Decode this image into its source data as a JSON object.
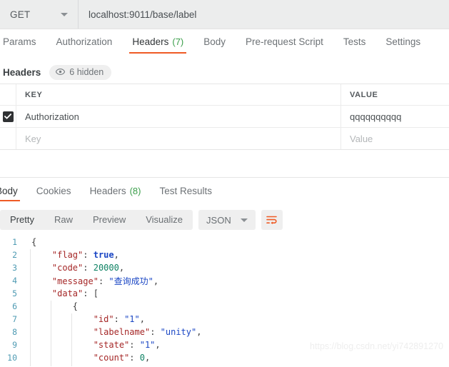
{
  "request_bar": {
    "method": "GET",
    "url": "localhost:9011/base/label",
    "caret_icon": "chevron-down-icon"
  },
  "request_tabs": [
    {
      "label": "Params",
      "count": "",
      "active": false
    },
    {
      "label": "Authorization",
      "count": "",
      "active": false
    },
    {
      "label": "Headers",
      "count": "(7)",
      "active": true
    },
    {
      "label": "Body",
      "count": "",
      "active": false
    },
    {
      "label": "Pre-request Script",
      "count": "",
      "active": false
    },
    {
      "label": "Tests",
      "count": "",
      "active": false
    },
    {
      "label": "Settings",
      "count": "",
      "active": false
    }
  ],
  "headers_section": {
    "title": "Headers",
    "hidden_pill": {
      "icon": "eye-icon",
      "label": "6 hidden"
    },
    "columns": {
      "key": "KEY",
      "value": "VALUE"
    },
    "rows": [
      {
        "checked": true,
        "key": "Authorization",
        "value": "qqqqqqqqqq"
      }
    ],
    "new_row": {
      "key_placeholder": "Key",
      "value_placeholder": "Value"
    }
  },
  "response_tabs": [
    {
      "label": "Body",
      "count": "",
      "active": true
    },
    {
      "label": "Cookies",
      "count": "",
      "active": false
    },
    {
      "label": "Headers",
      "count": "(8)",
      "active": false
    },
    {
      "label": "Test Results",
      "count": "",
      "active": false
    }
  ],
  "format_bar": {
    "views": [
      {
        "label": "Pretty",
        "active": true
      },
      {
        "label": "Raw",
        "active": false
      },
      {
        "label": "Preview",
        "active": false
      },
      {
        "label": "Visualize",
        "active": false
      }
    ],
    "language": "JSON",
    "language_caret_icon": "chevron-down-icon",
    "wrap_button_icon": "word-wrap-icon"
  },
  "json_body": {
    "lines": [
      {
        "num": "1",
        "indent": 0,
        "guides": 0,
        "tokens": [
          {
            "t": "{",
            "c": "p"
          }
        ]
      },
      {
        "num": "2",
        "indent": 1,
        "guides": 1,
        "tokens": [
          {
            "t": "\"flag\"",
            "c": "k"
          },
          {
            "t": ": ",
            "c": "p"
          },
          {
            "t": "true",
            "c": "b"
          },
          {
            "t": ",",
            "c": "p"
          }
        ]
      },
      {
        "num": "3",
        "indent": 1,
        "guides": 1,
        "tokens": [
          {
            "t": "\"code\"",
            "c": "k"
          },
          {
            "t": ": ",
            "c": "p"
          },
          {
            "t": "20000",
            "c": "n"
          },
          {
            "t": ",",
            "c": "p"
          }
        ]
      },
      {
        "num": "4",
        "indent": 1,
        "guides": 1,
        "tokens": [
          {
            "t": "\"message\"",
            "c": "k"
          },
          {
            "t": ": ",
            "c": "p"
          },
          {
            "t": "\"查询成功\"",
            "c": "s"
          },
          {
            "t": ",",
            "c": "p"
          }
        ]
      },
      {
        "num": "5",
        "indent": 1,
        "guides": 1,
        "tokens": [
          {
            "t": "\"data\"",
            "c": "k"
          },
          {
            "t": ": [",
            "c": "p"
          }
        ]
      },
      {
        "num": "6",
        "indent": 2,
        "guides": 2,
        "tokens": [
          {
            "t": "{",
            "c": "p"
          }
        ]
      },
      {
        "num": "7",
        "indent": 3,
        "guides": 3,
        "tokens": [
          {
            "t": "\"id\"",
            "c": "k"
          },
          {
            "t": ": ",
            "c": "p"
          },
          {
            "t": "\"1\"",
            "c": "s"
          },
          {
            "t": ",",
            "c": "p"
          }
        ]
      },
      {
        "num": "8",
        "indent": 3,
        "guides": 3,
        "tokens": [
          {
            "t": "\"labelname\"",
            "c": "k"
          },
          {
            "t": ": ",
            "c": "p"
          },
          {
            "t": "\"unity\"",
            "c": "s"
          },
          {
            "t": ",",
            "c": "p"
          }
        ]
      },
      {
        "num": "9",
        "indent": 3,
        "guides": 3,
        "tokens": [
          {
            "t": "\"state\"",
            "c": "k"
          },
          {
            "t": ": ",
            "c": "p"
          },
          {
            "t": "\"1\"",
            "c": "s"
          },
          {
            "t": ",",
            "c": "p"
          }
        ]
      },
      {
        "num": "10",
        "indent": 3,
        "guides": 3,
        "tokens": [
          {
            "t": "\"count\"",
            "c": "k"
          },
          {
            "t": ": ",
            "c": "p"
          },
          {
            "t": "0",
            "c": "n"
          },
          {
            "t": ",",
            "c": "p"
          }
        ]
      }
    ]
  },
  "watermark": "https://blog.csdn.net/yi742891270",
  "colors": {
    "accent": "#ef5b25",
    "count_green": "#3a9e4a",
    "bar_bg": "#eceded",
    "json_key": "#a52727",
    "json_string": "#1a46c4",
    "json_number": "#0e8264"
  }
}
